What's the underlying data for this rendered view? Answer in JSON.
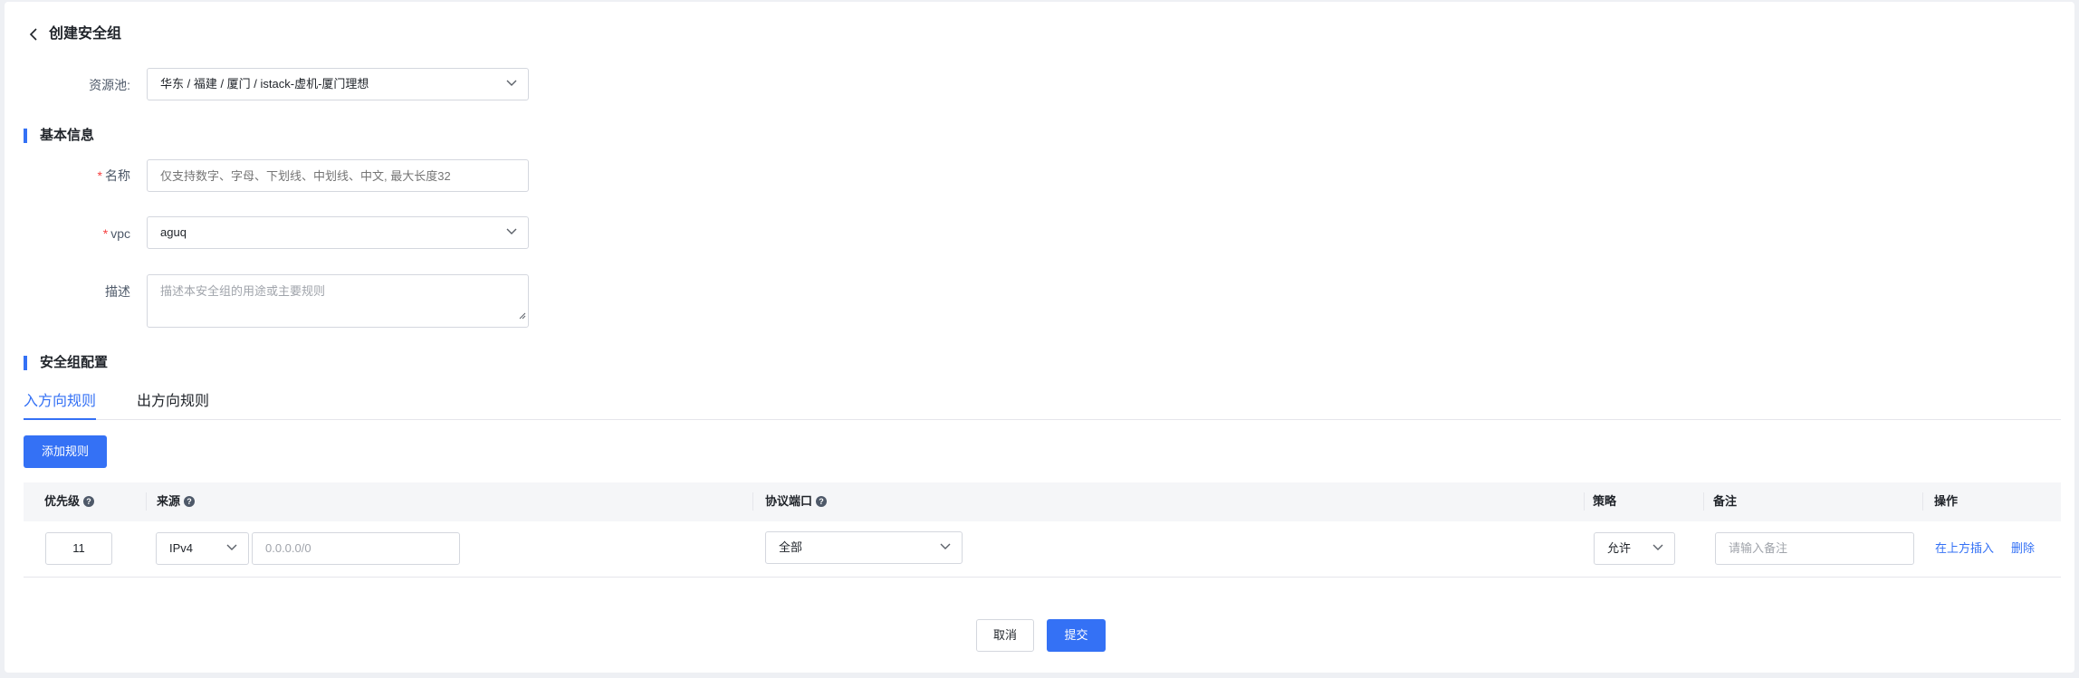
{
  "header": {
    "title": "创建安全组"
  },
  "resource_pool": {
    "label": "资源池:",
    "value": "华东 / 福建 / 厦门 / istack-虚机-厦门理想"
  },
  "basic_info": {
    "title": "基本信息",
    "name": {
      "label": "名称",
      "placeholder": "仅支持数字、字母、下划线、中划线、中文, 最大长度32"
    },
    "vpc": {
      "label": "vpc",
      "value": "aguq"
    },
    "description": {
      "label": "描述",
      "placeholder": "描述本安全组的用途或主要规则"
    }
  },
  "sg_config": {
    "title": "安全组配置",
    "tabs": [
      {
        "label": "入方向规则"
      },
      {
        "label": "出方向规则"
      }
    ],
    "add_rule_label": "添加规则",
    "columns": {
      "priority": "优先级",
      "source": "来源",
      "protocol_port": "协议端口",
      "policy": "策略",
      "remark": "备注",
      "actions": "操作"
    },
    "rows": [
      {
        "priority": "11",
        "ip_version": "IPv4",
        "source_ip_placeholder": "0.0.0.0/0",
        "protocol": "全部",
        "policy": "允许",
        "remark_placeholder": "请输入备注",
        "insert_above_label": "在上方插入",
        "delete_label": "删除"
      }
    ]
  },
  "footer": {
    "cancel_label": "取消",
    "submit_label": "提交"
  },
  "colors": {
    "primary": "#3471f5",
    "required": "#f53f3f",
    "background": "#eef0f4"
  },
  "icons": {
    "back": "chevron-left-icon",
    "dropdown": "chevron-down-icon",
    "help": "question-circle-icon"
  }
}
